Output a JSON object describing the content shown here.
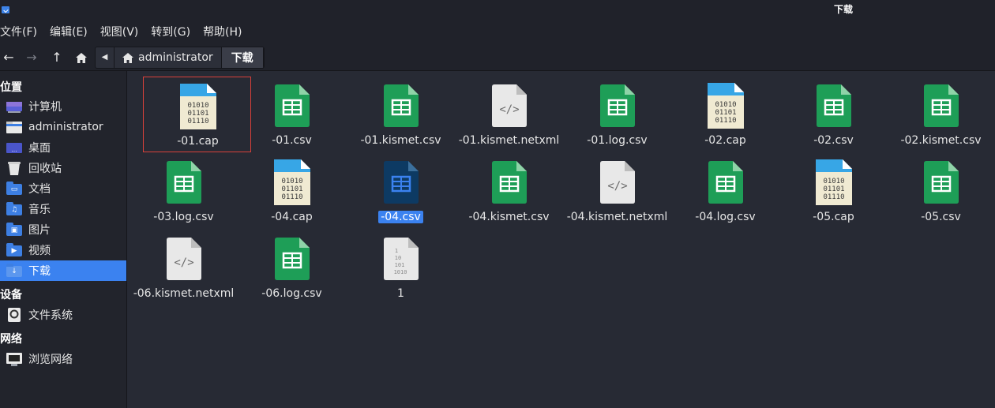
{
  "window": {
    "title": "下载"
  },
  "menu": {
    "items": [
      "文件(F)",
      "编辑(E)",
      "视图(V)",
      "转到(G)",
      "帮助(H)"
    ]
  },
  "toolbar": {
    "back_glyph": "←",
    "forward_glyph": "→",
    "up_glyph": "↑",
    "path": [
      "administrator",
      "下载"
    ]
  },
  "sidebar": {
    "sections": [
      {
        "title": "位置",
        "items": [
          {
            "label": "计算机",
            "icon": "computer-icon"
          },
          {
            "label": "administrator",
            "icon": "home-folder-icon"
          },
          {
            "label": "桌面",
            "icon": "desktop-icon"
          },
          {
            "label": "回收站",
            "icon": "trash-icon"
          },
          {
            "label": "文档",
            "icon": "documents-icon"
          },
          {
            "label": "音乐",
            "icon": "music-icon"
          },
          {
            "label": "图片",
            "icon": "pictures-icon"
          },
          {
            "label": "视频",
            "icon": "videos-icon"
          },
          {
            "label": "下载",
            "icon": "downloads-icon",
            "selected": true
          }
        ]
      },
      {
        "title": "设备",
        "items": [
          {
            "label": "文件系统",
            "icon": "drive-icon"
          }
        ]
      },
      {
        "title": "网络",
        "items": [
          {
            "label": "浏览网络",
            "icon": "network-icon"
          }
        ]
      }
    ]
  },
  "files": [
    {
      "name": "-01.cap",
      "type": "binary",
      "focused": true
    },
    {
      "name": "-01.csv",
      "type": "spreadsheet"
    },
    {
      "name": "-01.kismet.csv",
      "type": "spreadsheet"
    },
    {
      "name": "-01.kismet.netxml",
      "type": "xml"
    },
    {
      "name": "-01.log.csv",
      "type": "spreadsheet"
    },
    {
      "name": "-02.cap",
      "type": "binary"
    },
    {
      "name": "-02.csv",
      "type": "spreadsheet"
    },
    {
      "name": "-02.kismet.csv",
      "type": "spreadsheet"
    },
    {
      "name": "-03.log.csv",
      "type": "spreadsheet"
    },
    {
      "name": "-04.cap",
      "type": "binary"
    },
    {
      "name": "-04.csv",
      "type": "spreadsheet",
      "selected": true
    },
    {
      "name": "-04.kismet.csv",
      "type": "spreadsheet"
    },
    {
      "name": "-04.kismet.netxml",
      "type": "xml"
    },
    {
      "name": "-04.log.csv",
      "type": "spreadsheet"
    },
    {
      "name": "-05.cap",
      "type": "binary"
    },
    {
      "name": "-05.csv",
      "type": "spreadsheet"
    },
    {
      "name": "-06.kismet.netxml",
      "type": "xml"
    },
    {
      "name": "-06.log.csv",
      "type": "spreadsheet"
    },
    {
      "name": "1",
      "type": "plain"
    }
  ],
  "colors": {
    "accent": "#3b82f0",
    "spreadsheet": "#1e9e57",
    "focus_border": "#d9413a"
  }
}
